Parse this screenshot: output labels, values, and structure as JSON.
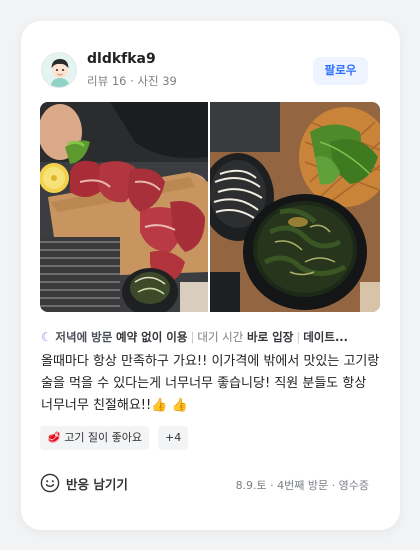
{
  "user": {
    "name": "dldkfka9",
    "stats": "리뷰 16 · 사진 39"
  },
  "follow_label": "팔로우",
  "visit_tags": {
    "moon_icon": "crescent-moon-icon",
    "visit_time": "저녁에 방문",
    "reservation": "예약 없이 이용",
    "wait_label": "대기 시간",
    "wait_value": "바로 입장",
    "purpose": "데이트..."
  },
  "review": "올때마다 항상 만족하구 가요!! 이가격에 밖에서 맛있는 고기랑 술을 먹을 수 있다는게 너무너무 좋습니당! 직원 분들도 항상 너무너무 친절해요!!👍 👍",
  "chips": {
    "main": "🥩 고기 질이 좋아요",
    "more": "+4"
  },
  "reaction_label": "반응 남기기",
  "meta": "8.9.토 · 4번째 방문 · 영수증",
  "colors": {
    "accent": "#2f6fff",
    "follow_bg": "#eef4ff",
    "moon": "#7c8cff"
  }
}
